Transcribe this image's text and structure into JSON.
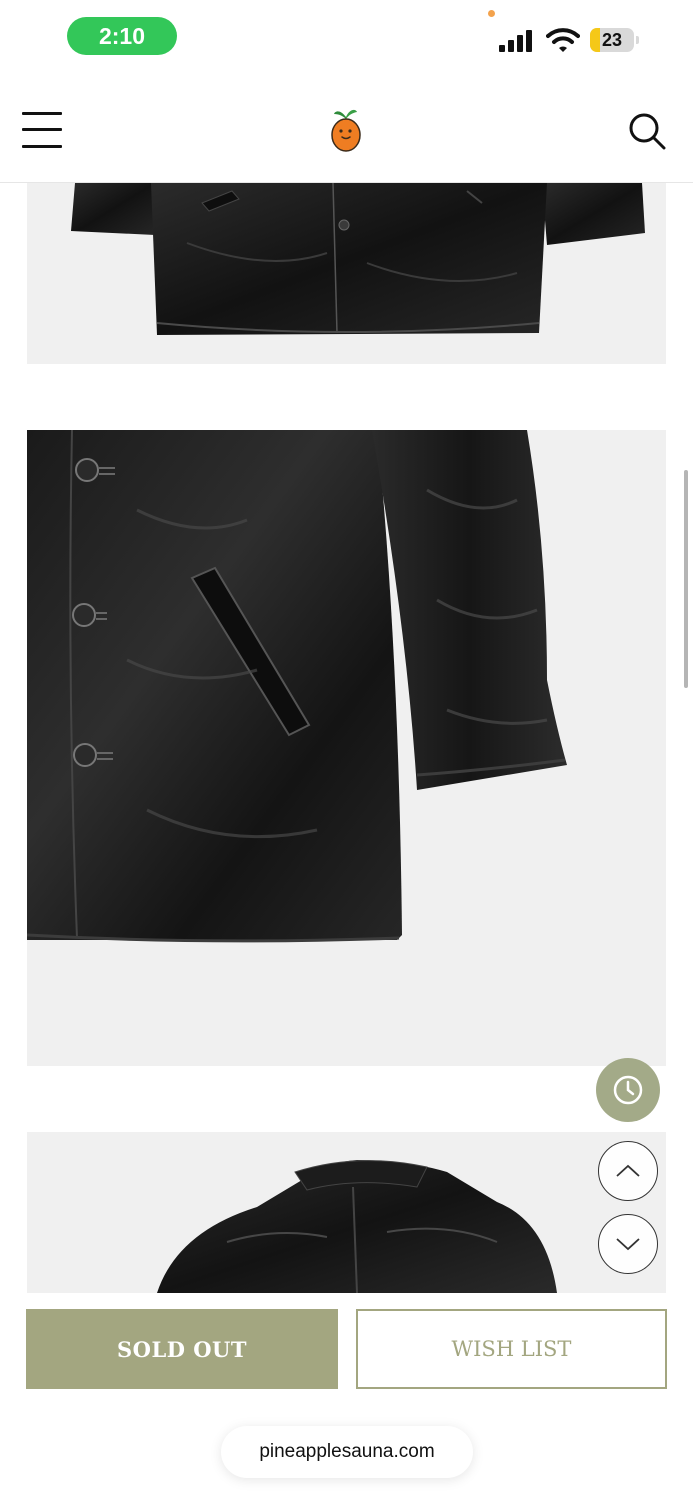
{
  "status_bar": {
    "time": "2:10",
    "battery_level": "23",
    "battery_fraction": 0.23
  },
  "header": {
    "menu_icon": "hamburger-menu-icon",
    "logo": "orange-mascot-logo",
    "search_icon": "search-icon"
  },
  "gallery": {
    "images": [
      {
        "subject": "black leather jacket hem"
      },
      {
        "subject": "black leather jacket front pocket and sleeve"
      },
      {
        "subject": "black leather jacket collar"
      }
    ]
  },
  "floating_buttons": {
    "recent_icon": "clock-icon",
    "up_icon": "chevron-up-icon",
    "down_icon": "chevron-down-icon"
  },
  "actions": {
    "sold_out_label": "SOLD OUT",
    "wish_list_label": "WISH LIST"
  },
  "browser": {
    "url": "pineapplesauna.com"
  },
  "colors": {
    "accent": "#a3a680",
    "status_pill": "#33c759",
    "battery": "#f5c818"
  }
}
